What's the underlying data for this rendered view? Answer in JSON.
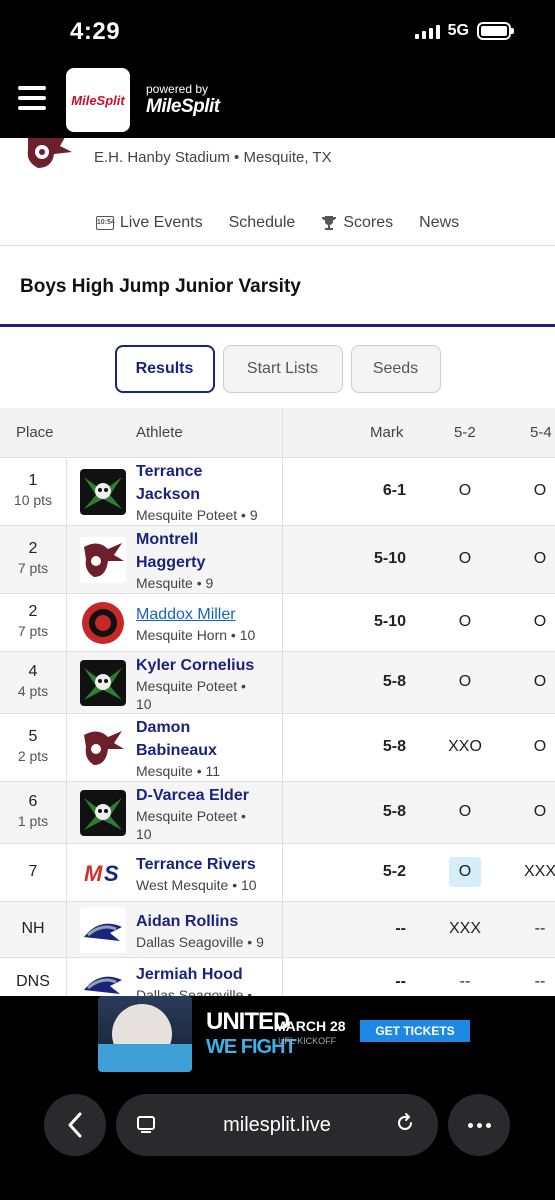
{
  "status_bar": {
    "time": "4:29",
    "network": "5G"
  },
  "header": {
    "logo_text": "MileSplit",
    "powered_by": "powered by",
    "brand": "MileSplit"
  },
  "meet": {
    "location": "E.H. Hanby Stadium • Mesquite, TX"
  },
  "nav": {
    "live_icon_text": "10:54",
    "items": [
      {
        "label": "Live Events",
        "icon": "live-clock-icon"
      },
      {
        "label": "Schedule",
        "icon": ""
      },
      {
        "label": "Scores",
        "icon": "trophy-icon"
      },
      {
        "label": "News",
        "icon": ""
      }
    ]
  },
  "event": {
    "title": "Boys High Jump Junior Varsity"
  },
  "segments": {
    "results": "Results",
    "start_lists": "Start Lists",
    "seeds": "Seeds",
    "active": "Results"
  },
  "table": {
    "headers": {
      "place": "Place",
      "athlete": "Athlete",
      "mark": "Mark",
      "h1": "5-2",
      "h2": "5-4"
    },
    "rows": [
      {
        "place": "1",
        "pts": "10 pts",
        "name_line1": "Terrance",
        "name_line2": "Jackson",
        "team_line1": "Mesquite Poteet • 9",
        "team_line2": "",
        "mark": "6-1",
        "a1": "O",
        "a2": "O",
        "logo": "poteet"
      },
      {
        "place": "2",
        "pts": "7 pts",
        "name_line1": "Montrell",
        "name_line2": "Haggerty",
        "team_line1": "Mesquite • 9",
        "team_line2": "",
        "mark": "5-10",
        "a1": "O",
        "a2": "O",
        "logo": "mesquite"
      },
      {
        "place": "2",
        "pts": "7 pts",
        "name_line1": "Maddox Miller",
        "name_line2": "",
        "team_line1": "Mesquite Horn • 10",
        "team_line2": "",
        "mark": "5-10",
        "a1": "O",
        "a2": "O",
        "logo": "horn"
      },
      {
        "place": "4",
        "pts": "4 pts",
        "name_line1": "Kyler Cornelius",
        "name_line2": "",
        "team_line1": "Mesquite Poteet •",
        "team_line2": "10",
        "mark": "5-8",
        "a1": "O",
        "a2": "O",
        "logo": "poteet"
      },
      {
        "place": "5",
        "pts": "2 pts",
        "name_line1": "Damon",
        "name_line2": "Babineaux",
        "team_line1": "Mesquite • 11",
        "team_line2": "",
        "mark": "5-8",
        "a1": "XXO",
        "a2": "O",
        "logo": "mesquite"
      },
      {
        "place": "6",
        "pts": "1 pts",
        "name_line1": "D-Varcea Elder",
        "name_line2": "",
        "team_line1": "Mesquite Poteet •",
        "team_line2": "10",
        "mark": "5-8",
        "a1": "O",
        "a2": "O",
        "logo": "poteet"
      },
      {
        "place": "7",
        "pts": "",
        "name_line1": "Terrance Rivers",
        "name_line2": "",
        "team_line1": "West Mesquite • 10",
        "team_line2": "",
        "mark": "5-2",
        "a1": "O",
        "a2": "XXX",
        "logo": "ms"
      },
      {
        "place": "NH",
        "pts": "",
        "name_line1": "Aidan Rollins",
        "name_line2": "",
        "team_line1": "Dallas Seagoville • 9",
        "team_line2": "",
        "mark": "--",
        "a1": "XXX",
        "a2": "--",
        "logo": "seagoville"
      },
      {
        "place": "DNS",
        "pts": "",
        "name_line1": "Jermiah Hood",
        "name_line2": "",
        "team_line1": "Dallas Seagoville •",
        "team_line2": "",
        "mark": "--",
        "a1": "--",
        "a2": "--",
        "logo": "seagoville"
      }
    ]
  },
  "ad": {
    "line1": "UNITED",
    "line2": "WE FIGHT",
    "date": "MARCH 28",
    "sub": "UFL KICKOFF",
    "cta": "GET TICKETS"
  },
  "browser": {
    "url": "milesplit.live"
  },
  "colors": {
    "navy": "#1a237e",
    "link": "#1565c0",
    "highlight": "#d6eefc"
  }
}
